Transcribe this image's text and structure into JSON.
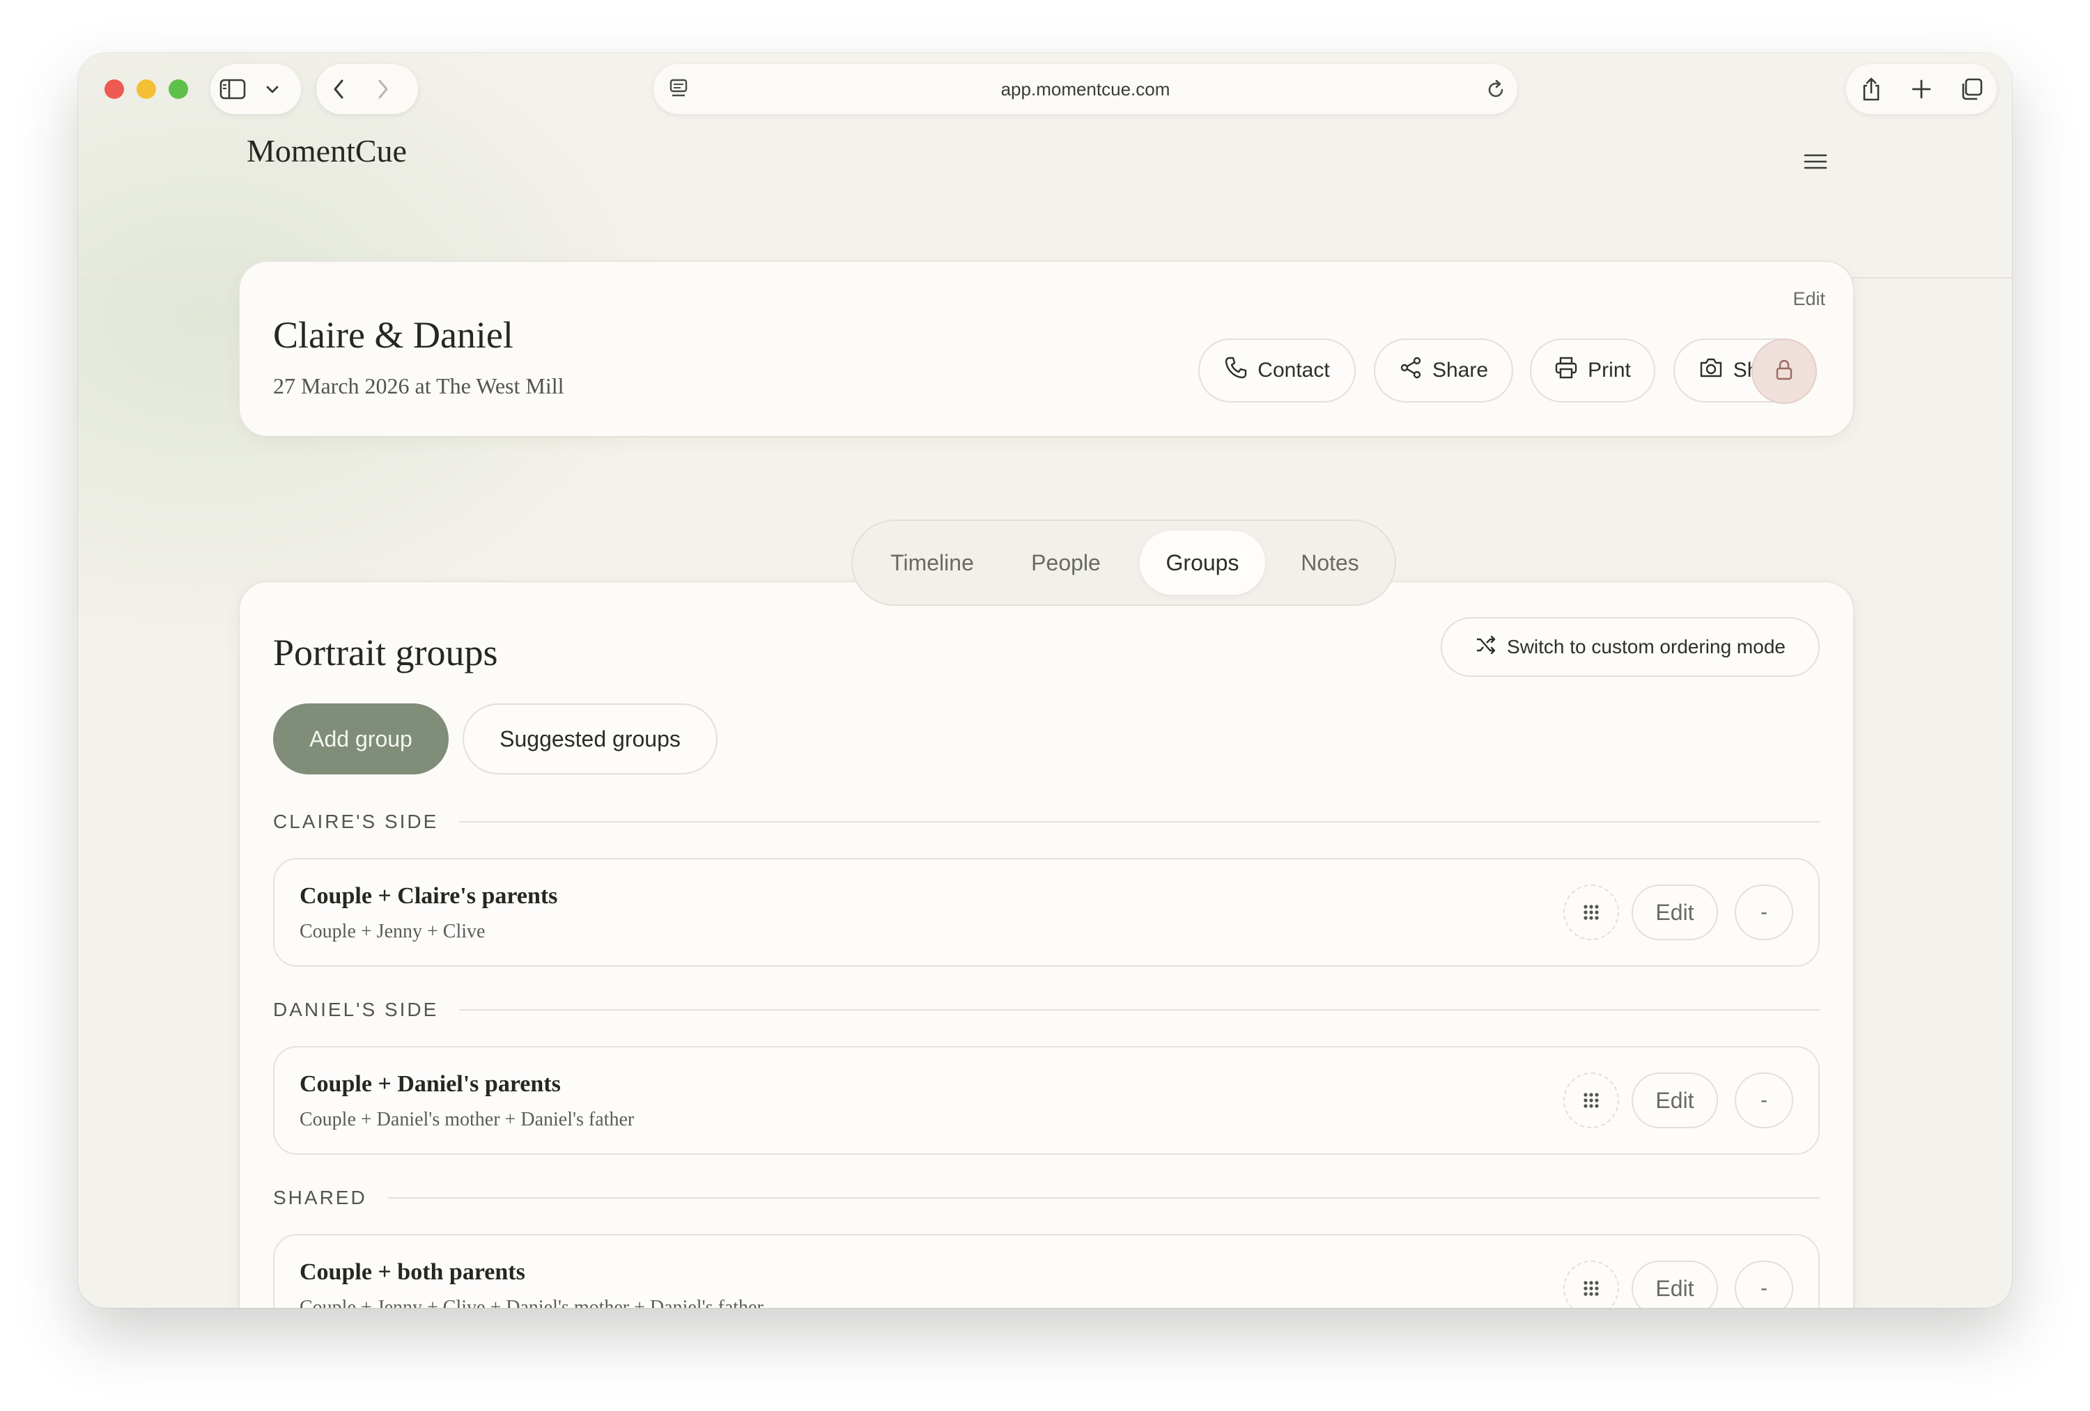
{
  "browser": {
    "url": "app.momentcue.com",
    "traffic_colors": [
      "#ed5a52",
      "#f4bf36",
      "#5fc049"
    ]
  },
  "app": {
    "logo": "MomentCue"
  },
  "event": {
    "title": "Claire & Daniel",
    "subtitle": "27 March 2026 at The West Mill",
    "edit_label": "Edit",
    "actions": {
      "contact": "Contact",
      "share": "Share",
      "print": "Print",
      "shoot": "Shoot"
    }
  },
  "tabs": [
    {
      "label": "Timeline",
      "active": false
    },
    {
      "label": "People",
      "active": false
    },
    {
      "label": "Groups",
      "active": true
    },
    {
      "label": "Notes",
      "active": false
    }
  ],
  "groups": {
    "title": "Portrait groups",
    "switch_label": "Switch to custom ordering mode",
    "add_label": "Add group",
    "suggested_label": "Suggested groups",
    "edit_label": "Edit",
    "remove_label": "-",
    "sections": [
      {
        "label": "CLAIRE'S SIDE",
        "items": [
          {
            "name": "Couple + Claire's parents",
            "members": "Couple + Jenny + Clive"
          }
        ]
      },
      {
        "label": "DANIEL'S SIDE",
        "items": [
          {
            "name": "Couple + Daniel's parents",
            "members": "Couple + Daniel's mother + Daniel's father"
          }
        ]
      },
      {
        "label": "SHARED",
        "items": [
          {
            "name": "Couple + both parents",
            "members": "Couple + Jenny + Clive + Daniel's mother + Daniel's father"
          }
        ]
      }
    ]
  },
  "colors": {
    "accent_green": "#7f8d79",
    "lock_bg": "#efe0db",
    "page_bg": "#f4f2ec"
  }
}
